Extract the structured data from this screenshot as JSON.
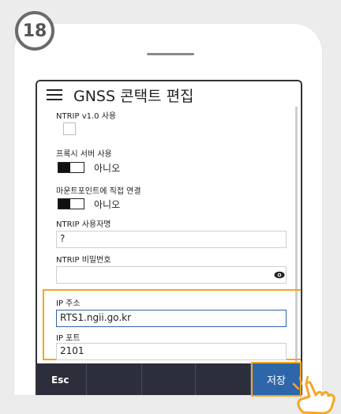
{
  "step_badge": "18",
  "app": {
    "title": "GNSS 콘택트 편집"
  },
  "form": {
    "ntrip_v1_label": "NTRIP v1.0 사용",
    "proxy_label": "프록시 서버 사용",
    "proxy_value": "아니오",
    "mount_label": "마운트포인트에 직접 연결",
    "mount_value": "아니오",
    "username_label": "NTRIP 사용자명",
    "username_value": "?",
    "password_label": "NTRIP 비밀번호",
    "ip_label": "IP 주소",
    "ip_value": "RTS1.ngii.go.kr",
    "port_label": "IP 포트",
    "port_value": "2101"
  },
  "toolbar": {
    "esc_label": "Esc",
    "save_label": "저장"
  },
  "colors": {
    "highlight": "#f5a623",
    "save_button": "#2e67a9",
    "toolbar": "#2c2e3b"
  },
  "icons": [
    "menu-icon",
    "eye-icon",
    "pointing-hand-icon"
  ]
}
